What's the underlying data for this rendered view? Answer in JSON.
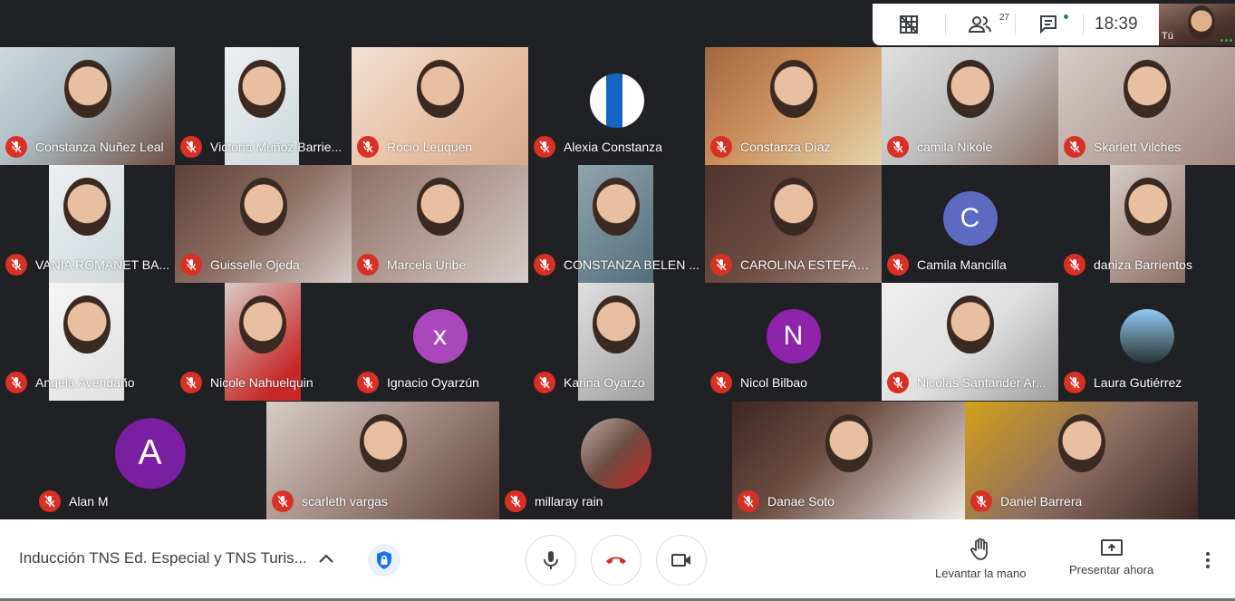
{
  "top_bar": {
    "grid_icon": "grid-layout-icon",
    "people_icon": "people-icon",
    "participant_count": "27",
    "chat_icon": "chat-icon",
    "clock": "18:39"
  },
  "self_view": {
    "label": "Tú"
  },
  "tiles": [
    {
      "name": "Constanza Nuñez Leal"
    },
    {
      "name": "Victoria Muñoz Barrie..."
    },
    {
      "name": "Rocio Leuquen"
    },
    {
      "name": "Alexia Constanza"
    },
    {
      "name": "Constanza Díaz"
    },
    {
      "name": "camila Nikole"
    },
    {
      "name": "Skarlett Vilches"
    },
    {
      "name": "VANIA ROMANET BA..."
    },
    {
      "name": "Guisselle Ojeda"
    },
    {
      "name": "Marcela Uribe"
    },
    {
      "name": "CONSTANZA BELEN ..."
    },
    {
      "name": "CAROLINA ESTEFANI..."
    },
    {
      "name": "Camila Mancilla",
      "letter": "C",
      "color": "#5c6bc0"
    },
    {
      "name": "daniza Barrientos"
    },
    {
      "name": "Angela Avendaño"
    },
    {
      "name": "Nicole Nahuelquin"
    },
    {
      "name": "Ignacio Oyarzún",
      "letter": "x",
      "color": "#ab47bc"
    },
    {
      "name": "Karina Oyarzo"
    },
    {
      "name": "Nicol Bilbao",
      "letter": "N",
      "color": "#8e24aa"
    },
    {
      "name": "Nicolás Santander Ar..."
    },
    {
      "name": "Laura Gutiérrez"
    },
    {
      "name": "Alan M",
      "letter": "A",
      "color": "#7b1fa2"
    },
    {
      "name": "scarleth vargas"
    },
    {
      "name": "millaray rain"
    },
    {
      "name": "Danae Soto"
    },
    {
      "name": "Daniel Barrera"
    }
  ],
  "bottom_bar": {
    "meeting_title": "Inducción TNS Ed. Especial y TNS Turis...",
    "raise_hand_label": "Levantar la mano",
    "present_label": "Presentar ahora"
  },
  "colors": {
    "mute_red": "#d93025",
    "end_call_red": "#d93025",
    "tile_bg": "#202124"
  }
}
